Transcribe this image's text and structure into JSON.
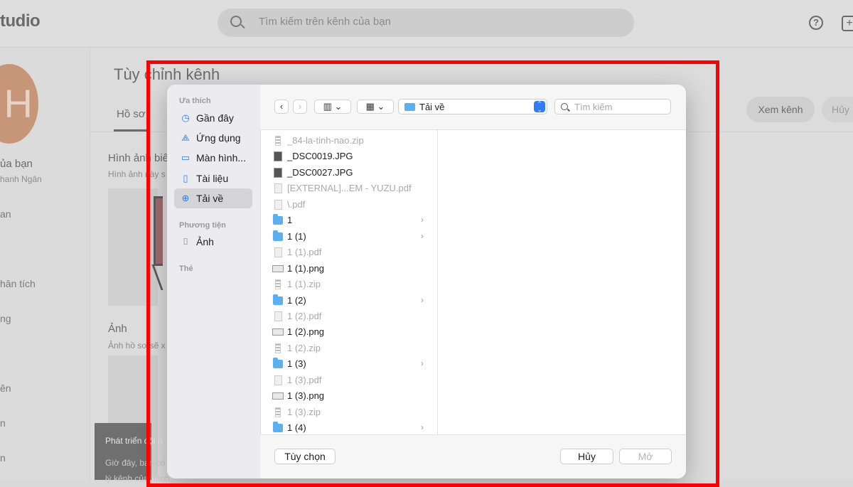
{
  "background": {
    "logo": "tudio",
    "search_placeholder": "Tìm kiếm trên kênh của bạn",
    "help_icon": "?",
    "create_icon": "+",
    "avatar_letter": "H",
    "channel_label": "ủa bạn",
    "channel_name": "hanh Ngân",
    "nav": [
      "an",
      "hân tích",
      "ng",
      "ên",
      "n",
      "n"
    ],
    "page_title": "Tùy chỉnh kênh",
    "tab_profile": "Hồ sơ",
    "btn_view_channel": "Xem kênh",
    "btn_cancel": "Hủy",
    "section1_title": "Hình ảnh biê",
    "section1_sub": "Hình ảnh này s",
    "section2_title": "Ảnh",
    "section2_sub": "Ảnh hồ sơ sẽ x",
    "toast_title": "Phát triển đội n",
    "toast_line1": "Giờ đây, bạn có",
    "toast_line2": "lý kênh của mình"
  },
  "dialog": {
    "sidebar": {
      "favorites_header": "Ưa thích",
      "favorites": [
        {
          "label": "Gần đây",
          "icon": "clock-icon"
        },
        {
          "label": "Ứng dụng",
          "icon": "apps-icon"
        },
        {
          "label": "Màn hình...",
          "icon": "desktop-icon"
        },
        {
          "label": "Tài liệu",
          "icon": "document-icon"
        },
        {
          "label": "Tải về",
          "icon": "download-icon"
        }
      ],
      "media_header": "Phương tiện",
      "media": [
        {
          "label": "Ảnh",
          "icon": "camera-icon"
        }
      ],
      "tags_header": "Thẻ"
    },
    "toolbar": {
      "back": "‹",
      "forward": "›",
      "location": "Tải về",
      "search_placeholder": "Tìm kiếm"
    },
    "files": [
      {
        "name": "_84-la-tinh-nao.zip",
        "type": "zip",
        "enabled": false
      },
      {
        "name": "_DSC0019.JPG",
        "type": "img",
        "enabled": true
      },
      {
        "name": "_DSC0027.JPG",
        "type": "img",
        "enabled": true
      },
      {
        "name": "[EXTERNAL]...EM - YUZU.pdf",
        "type": "pdf",
        "enabled": false
      },
      {
        "name": "\\.pdf",
        "type": "pdf",
        "enabled": false
      },
      {
        "name": "1",
        "type": "folder",
        "enabled": true
      },
      {
        "name": "1 (1)",
        "type": "folder",
        "enabled": true
      },
      {
        "name": "1 (1).pdf",
        "type": "pdf",
        "enabled": false
      },
      {
        "name": "1 (1).png",
        "type": "png",
        "enabled": true
      },
      {
        "name": "1 (1).zip",
        "type": "zip",
        "enabled": false
      },
      {
        "name": "1 (2)",
        "type": "folder",
        "enabled": true
      },
      {
        "name": "1 (2).pdf",
        "type": "pdf",
        "enabled": false
      },
      {
        "name": "1 (2).png",
        "type": "png",
        "enabled": true
      },
      {
        "name": "1 (2).zip",
        "type": "zip",
        "enabled": false
      },
      {
        "name": "1 (3)",
        "type": "folder",
        "enabled": true
      },
      {
        "name": "1 (3).pdf",
        "type": "pdf",
        "enabled": false
      },
      {
        "name": "1 (3).png",
        "type": "png",
        "enabled": true
      },
      {
        "name": "1 (3).zip",
        "type": "zip",
        "enabled": false
      },
      {
        "name": "1 (4)",
        "type": "folder",
        "enabled": true
      }
    ],
    "footer": {
      "options": "Tùy chọn",
      "cancel": "Hủy",
      "open": "Mở"
    }
  },
  "highlight_color": "#ff0000"
}
